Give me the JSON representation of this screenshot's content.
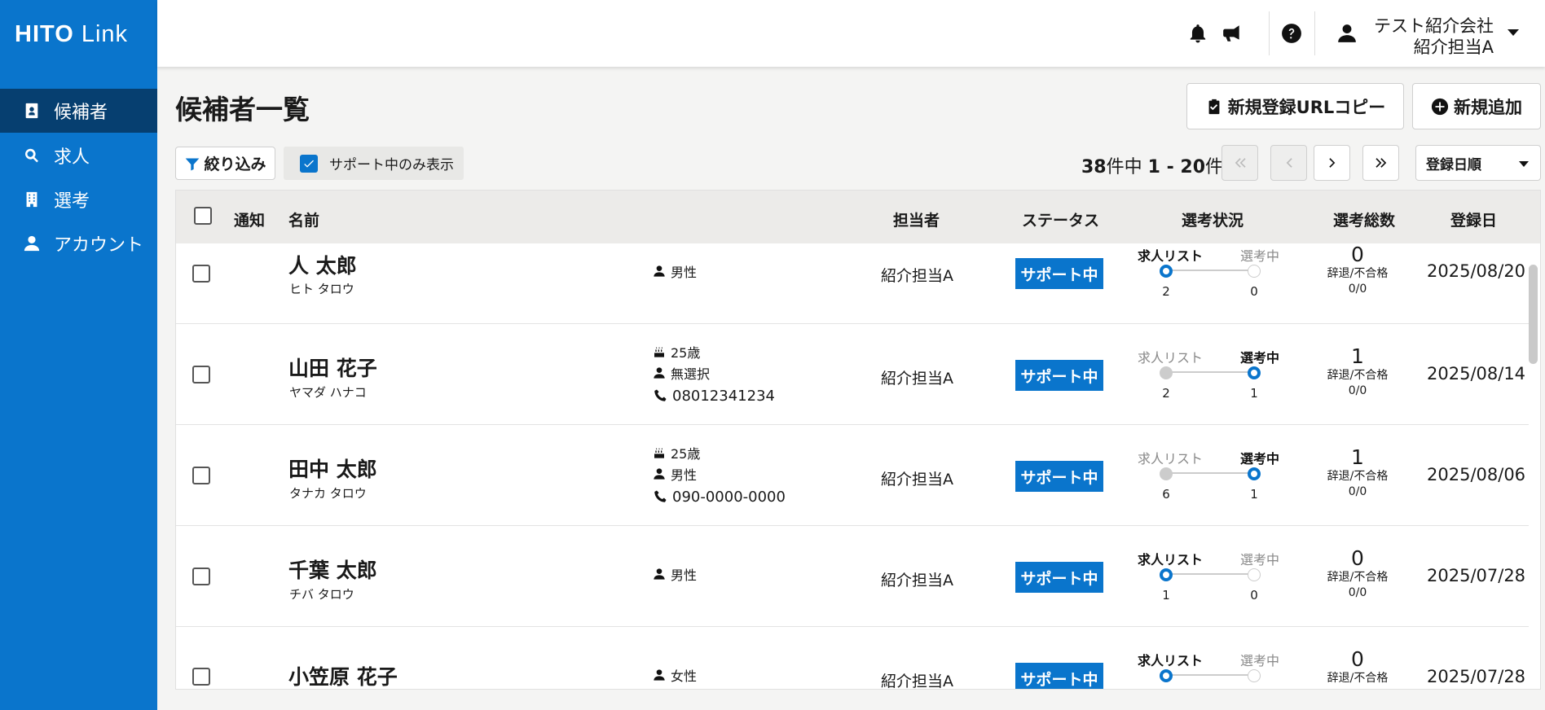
{
  "app": {
    "logo_bold": "HITO",
    "logo_light": "Link"
  },
  "sidebar": {
    "items": [
      {
        "label": "候補者",
        "icon": "id-card-icon",
        "active": true
      },
      {
        "label": "求人",
        "icon": "search-icon",
        "active": false
      },
      {
        "label": "選考",
        "icon": "building-icon",
        "active": false
      },
      {
        "label": "アカウント",
        "icon": "user-icon",
        "active": false
      }
    ]
  },
  "header": {
    "company": "テスト紹介会社",
    "user_name": "紹介担当A"
  },
  "page": {
    "title": "候補者一覧",
    "copy_url_button": "新規登録URLコピー",
    "add_button": "新規追加",
    "filter_button": "絞り込み",
    "support_only_label": "サポート中のみ表示",
    "count_total": "38",
    "count_middle": "件中 ",
    "count_range": "1 - 20",
    "count_suffix": "件",
    "sort_selected": "登録日順"
  },
  "table": {
    "headers": {
      "notify": "通知",
      "name": "名前",
      "owner": "担当者",
      "status": "ステータス",
      "selection": "選考状況",
      "total": "選考総数",
      "date": "登録日"
    },
    "stage_labels": {
      "list": "求人リスト",
      "in_progress": "選考中"
    },
    "declined_label": "辞退/不合格",
    "rows": [
      {
        "name": "人 太郎",
        "kana": "ヒト タロウ",
        "age": "",
        "gender": "男性",
        "phone": "",
        "owner": "紹介担当A",
        "status": "サポート中",
        "list_count": "2",
        "progress_count": "0",
        "active_stage": "list",
        "total": "0",
        "declined": "0/0",
        "date": "2025/08/20"
      },
      {
        "name": "山田 花子",
        "kana": "ヤマダ ハナコ",
        "age": "25歳",
        "gender": "無選択",
        "phone": "08012341234",
        "owner": "紹介担当A",
        "status": "サポート中",
        "list_count": "2",
        "progress_count": "1",
        "active_stage": "in_progress",
        "total": "1",
        "declined": "0/0",
        "date": "2025/08/14"
      },
      {
        "name": "田中 太郎",
        "kana": "タナカ タロウ",
        "age": "25歳",
        "gender": "男性",
        "phone": "090-0000-0000",
        "owner": "紹介担当A",
        "status": "サポート中",
        "list_count": "6",
        "progress_count": "1",
        "active_stage": "in_progress",
        "total": "1",
        "declined": "0/0",
        "date": "2025/08/06"
      },
      {
        "name": "千葉 太郎",
        "kana": "チバ タロウ",
        "age": "",
        "gender": "男性",
        "phone": "",
        "owner": "紹介担当A",
        "status": "サポート中",
        "list_count": "1",
        "progress_count": "0",
        "active_stage": "list",
        "total": "0",
        "declined": "0/0",
        "date": "2025/07/28"
      },
      {
        "name": "小笠原 花子",
        "kana": "",
        "age": "",
        "gender": "女性",
        "phone": "",
        "owner": "紹介担当A",
        "status": "サポート中",
        "list_count": "",
        "progress_count": "",
        "active_stage": "list",
        "total": "0",
        "declined": "",
        "date": "2025/07/28"
      }
    ]
  },
  "colors": {
    "brand": "#0a75cc",
    "nav_active": "#063f70"
  }
}
